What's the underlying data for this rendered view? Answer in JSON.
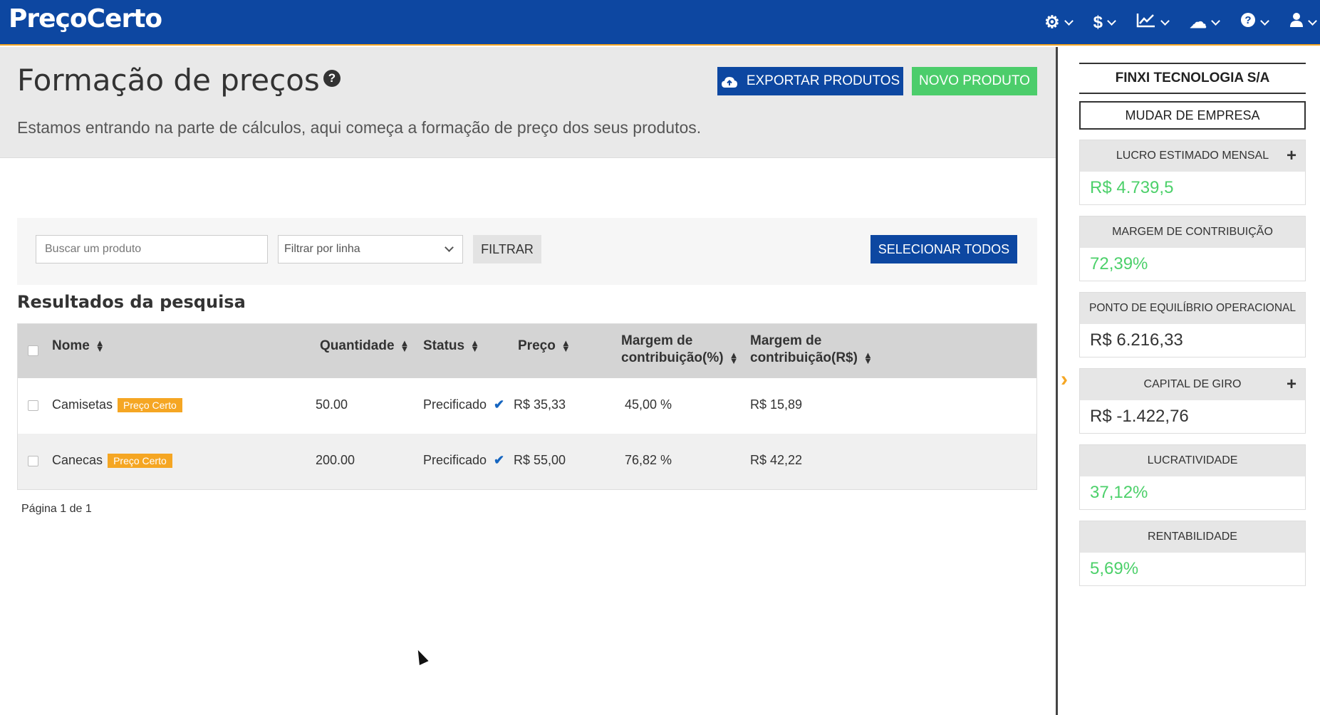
{
  "app": {
    "logo": "PreçoCerto"
  },
  "topnav": [
    {
      "icon": "gear-icon",
      "glyph": "⚙"
    },
    {
      "icon": "dollar-icon",
      "glyph": "$"
    },
    {
      "icon": "chart-icon",
      "glyph": "📈"
    },
    {
      "icon": "cloud-icon",
      "glyph": "☁"
    },
    {
      "icon": "question-icon",
      "glyph": "?"
    },
    {
      "icon": "user-icon",
      "glyph": "👤"
    }
  ],
  "header": {
    "title": "Formação de preços",
    "subtitle": "Estamos entrando na parte de cálculos, aqui começa a formação de preço dos seus produtos.",
    "export_label": "EXPORTAR PRODUTOS",
    "new_label": "NOVO PRODUTO"
  },
  "filters": {
    "search_placeholder": "Buscar um produto",
    "line_select": "Filtrar por linha",
    "filter_label": "FILTRAR",
    "select_all_label": "SELECIONAR TODOS"
  },
  "results": {
    "title": "Resultados da pesquisa",
    "columns": {
      "name": "Nome",
      "quantity": "Quantidade",
      "status": "Status",
      "price": "Preço",
      "margin_pct_1": "Margem de",
      "margin_pct_2": "contribuição(%)",
      "margin_rs_1": "Margem de",
      "margin_rs_2": "contribuição(R$)"
    },
    "rows": [
      {
        "name": "Camisetas",
        "badge": "Preço Certo",
        "quantity": "50.00",
        "status": "Precificado",
        "price": "R$ 35,33",
        "margin_pct": "45,00 %",
        "margin_rs": "R$ 15,89"
      },
      {
        "name": "Canecas",
        "badge": "Preço Certo",
        "quantity": "200.00",
        "status": "Precificado",
        "price": "R$ 55,00",
        "margin_pct": "76,82 %",
        "margin_rs": "R$ 42,22"
      }
    ],
    "pagination": "Página 1 de 1"
  },
  "sidebar": {
    "company": "FINXI TECNOLOGIA S/A",
    "switch_label": "MUDAR DE EMPRESA",
    "cards": [
      {
        "label": "LUCRO ESTIMADO MENSAL",
        "value": "R$ 4.739,5",
        "has_plus": true,
        "tone": "green"
      },
      {
        "label": "MARGEM DE CONTRIBUIÇÃO",
        "value": "72,39%",
        "has_plus": false,
        "tone": "green"
      },
      {
        "label": "PONTO DE EQUILÍBRIO OPERACIONAL",
        "value": "R$ 6.216,33",
        "has_plus": false,
        "tone": "dark"
      },
      {
        "label": "CAPITAL DE GIRO",
        "value": "R$ -1.422,76",
        "has_plus": true,
        "tone": "dark"
      },
      {
        "label": "LUCRATIVIDADE",
        "value": "37,12%",
        "has_plus": false,
        "tone": "green"
      },
      {
        "label": "RENTABILIDADE",
        "value": "5,69%",
        "has_plus": false,
        "tone": "green"
      }
    ]
  },
  "colors": {
    "primary": "#0d47a1",
    "accent": "#f5a623",
    "success": "#4ccd6b"
  }
}
